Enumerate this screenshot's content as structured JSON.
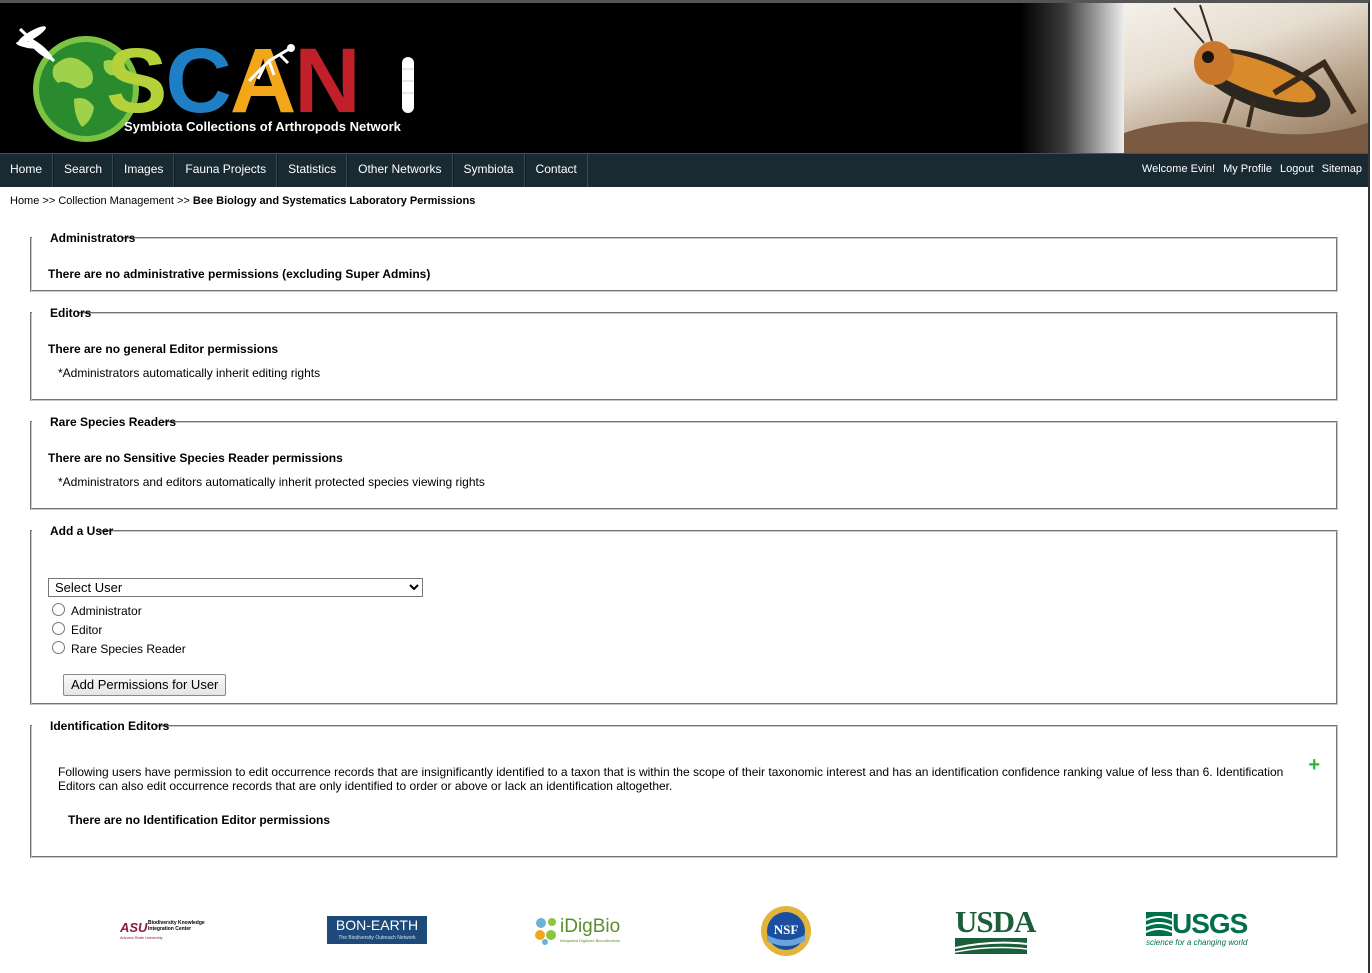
{
  "banner": {
    "logo_letters": [
      "S",
      "C",
      "A",
      "N"
    ],
    "logo_colors": [
      "#b6d23a",
      "#1f7fc4",
      "#f2a71b",
      "#c1202a"
    ],
    "logo_subtitle": "Symbiota Collections of Arthropods Network"
  },
  "nav": {
    "items": [
      "Home",
      "Search",
      "Images",
      "Fauna Projects",
      "Statistics",
      "Other Networks",
      "Symbiota",
      "Contact"
    ],
    "welcome": "Welcome Evin!",
    "my_profile": "My Profile",
    "logout": "Logout",
    "sitemap": "Sitemap"
  },
  "breadcrumb": {
    "home": "Home",
    "sep": ">>",
    "collection_management": "Collection Management",
    "current": "Bee Biology and Systematics Laboratory Permissions"
  },
  "administrators": {
    "legend": "Administrators",
    "message": "There are no administrative permissions (excluding Super Admins)"
  },
  "editors": {
    "legend": "Editors",
    "message": "There are no general Editor permissions",
    "note": "*Administrators automatically inherit editing rights"
  },
  "rare_species": {
    "legend": "Rare Species Readers",
    "message": "There are no Sensitive Species Reader permissions",
    "note": "*Administrators and editors automatically inherit protected species viewing rights"
  },
  "add_user": {
    "legend": "Add a User",
    "select_value": "Select User",
    "options": [
      "Administrator",
      "Editor",
      "Rare Species Reader"
    ],
    "button": "Add Permissions for User"
  },
  "identification_editors": {
    "legend": "Identification Editors",
    "description": "Following users have permission to edit occurrence records that are insignificantly identified to a taxon that is within the scope of their taxonomic interest and has an identification confidence ranking value of less than 6. Identification Editors can also edit occurrence records that are only identified to order or above or lack an identification altogether.",
    "message": "There are no Identification Editor permissions",
    "add_icon": "plus-icon"
  },
  "footer": {
    "asu_main": "Biodiversity Knowledge Integration Center",
    "asu_sub": "Arizona State University",
    "asu_abbr": "ASU",
    "bon_earth": "BON-EARTH",
    "bon_sub": "The Biodiversity Outreach Network",
    "idigbio": "iDigBio",
    "idigbio_sub": "Integrated Digitized Biocollections",
    "nsf": "NSF",
    "usda": "USDA",
    "usgs": "USGS",
    "usgs_sub": "science for a changing world"
  }
}
